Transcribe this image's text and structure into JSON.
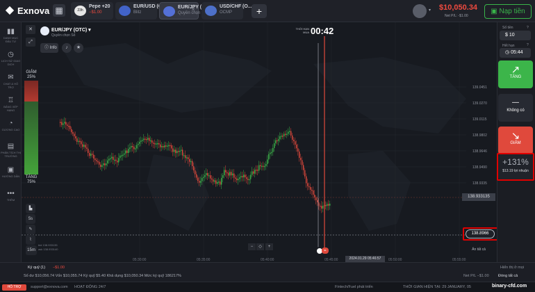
{
  "header": {
    "brand": "Exnova",
    "tabs": [
      {
        "title": "Pepe +20",
        "sub": "−$1.00"
      },
      {
        "title": "EUR/USD (O...",
        "sub": "Blitz"
      },
      {
        "title": "EUR/JPY (O...",
        "sub": "Quyền chọn Số"
      },
      {
        "title": "USD/CHF (O...",
        "sub": "OCMP"
      }
    ],
    "tab_badge": "23h",
    "balance": "$10,050.34",
    "net_pl": "Net P/L: -$1.00",
    "deposit_label": "Nạp tiền"
  },
  "sidebar": {
    "items": [
      {
        "label": "DANH MỤC ĐẦU TƯ",
        "icon": "▮▮"
      },
      {
        "label": "LỊCH SỬ GIAO DỊCH",
        "icon": "◷"
      },
      {
        "label": "CHAT & HỖ TRỢ",
        "icon": "✉"
      },
      {
        "label": "BẢNG XẾP HẠNG",
        "icon": "♖"
      },
      {
        "label": "GƯƠNG CAO",
        "icon": "◔"
      },
      {
        "label": "PHÂN TÍCH THỊ TRƯỜNG",
        "icon": "▤"
      },
      {
        "label": "HƯỚNG DẪN",
        "icon": "▣"
      },
      {
        "label": "THÊM",
        "icon": "•••"
      }
    ]
  },
  "asset": {
    "name": "EUR/JPY (OTC)",
    "type": "Quyền chọn Số",
    "info_label": "Info"
  },
  "timer": {
    "label": "THỜI HẠN MUA",
    "value": "00:42"
  },
  "signals": {
    "down_label": "GIẢM",
    "down_pct": "25%",
    "up_label": "TĂNG",
    "up_pct": "75%"
  },
  "tools": {
    "timeframe_5s": "5s",
    "timeframe_15m": "15m",
    "price_labels": [
      "bid 138.933135",
      "ask 138.933140"
    ]
  },
  "chart_data": {
    "type": "candlestick",
    "y_axis_ticks": [
      "139.0451",
      "139.0270",
      "139.0115",
      "138.9802",
      "138.9646",
      "138.9490",
      "138.9335"
    ],
    "x_axis_ticks": [
      "05:30:00",
      "05:35:00",
      "05:40:00",
      "05:45:00",
      "05:50:00",
      "05:55:00"
    ],
    "current_price": "138.933135",
    "strike_price": "138.8966",
    "expiry_time": "2024.01.29 05:46:57",
    "colors": {
      "up": "#3cb54a",
      "down": "#e0493c"
    }
  },
  "right_panel": {
    "amount_label": "Số tiền",
    "amount_value": "10",
    "expiry_label": "Hết hạn",
    "expiry_value": "05:44",
    "up_label": "TĂNG",
    "none_label": "Không có",
    "down_label": "GIẢM",
    "payout_pct": "+131%",
    "payout_profit": "$13.19 lợi nhuận",
    "close_all": "Ẩn tất cả"
  },
  "bottom": {
    "deposit_label": "Ký quỹ (1)",
    "deposit_value": "−$1.00",
    "close_all": "Đóng tất cả",
    "balance_line": "Số dư $10,056.74  Vốn $10,055.74  Ký quỹ $5.40  Khả dụng $10,050.34  Mức ký quỹ 186217%",
    "net_pl": "Net P/L −$1.00",
    "show_label": "Hiển thị ở mọi"
  },
  "statusbar": {
    "support_btn": "HỖ TRỢ",
    "email": "support@exnova.com",
    "hours": "HOẠT ĐỘNG 24/7",
    "provider": "Fintech/Fuel phát triển",
    "server_time": "THỜI GIAN HIỆN TẠI: 29 JANUARY, 05",
    "watermark": "binary-cfd.com"
  }
}
